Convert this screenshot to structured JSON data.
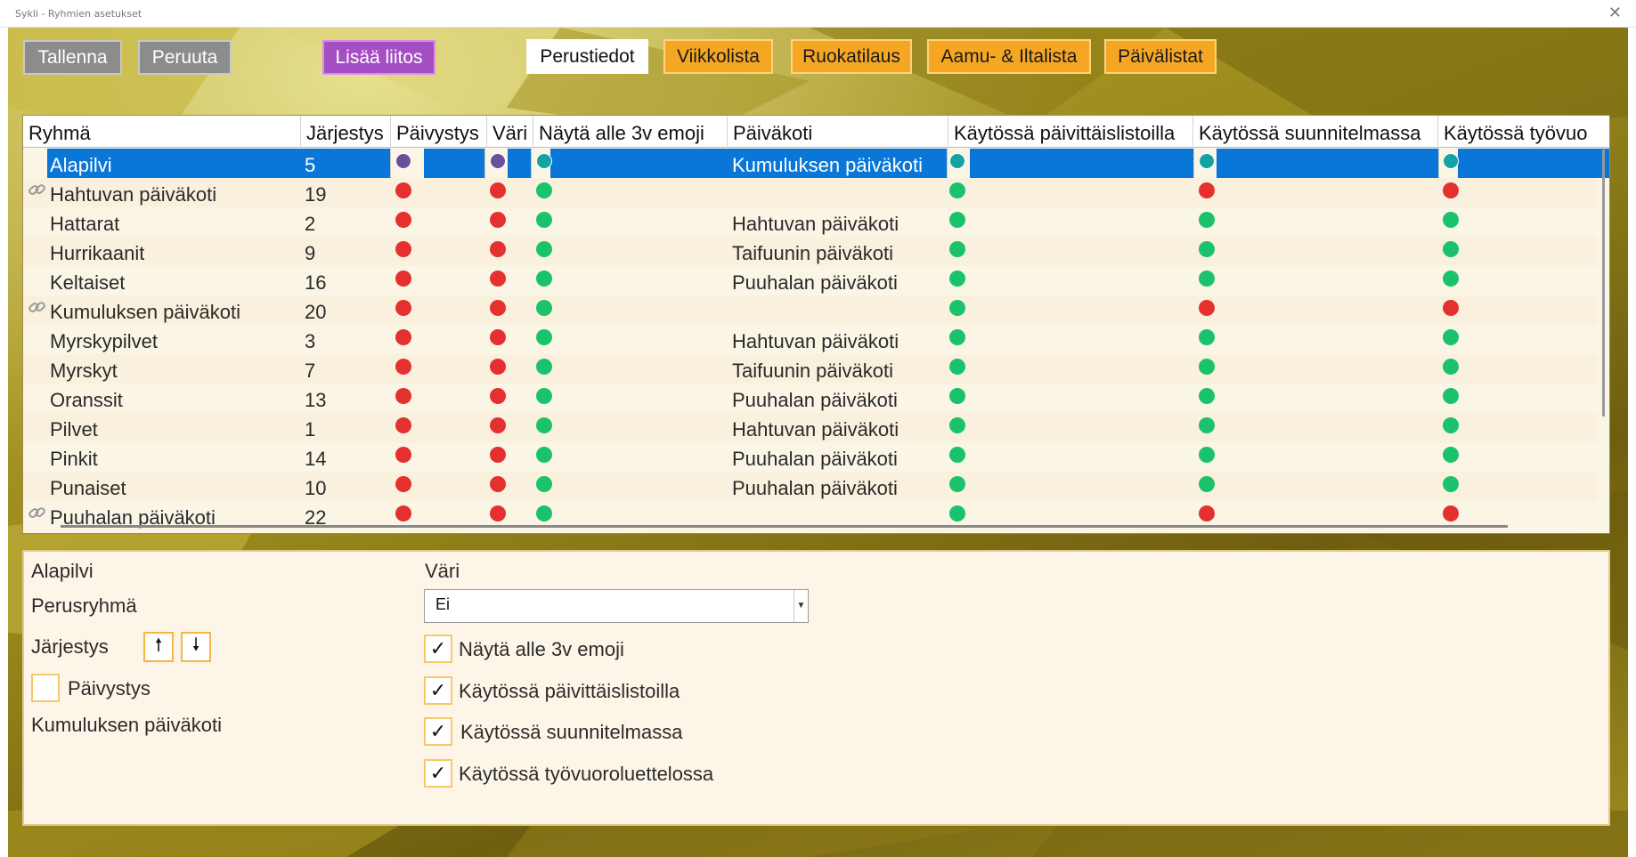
{
  "window": {
    "title": "Sykli - Ryhmien asetukset"
  },
  "toolbar": {
    "save": "Tallenna",
    "cancel": "Peruuta",
    "add_link": "Lisää liitos"
  },
  "tabs": [
    {
      "label": "Perustiedot",
      "active": true
    },
    {
      "label": "Viikkolista"
    },
    {
      "label": "Ruokatilaus"
    },
    {
      "label": "Aamu- & Iltalista"
    },
    {
      "label": "Päivälistat"
    }
  ],
  "grid": {
    "columns": [
      "Ryhmä",
      "Järjestys",
      "Päivystys",
      "Väri",
      "Näytä alle 3v emoji",
      "Päiväkoti",
      "Käytössä päivittäislistoilla",
      "Käytössä suunnitelmassa",
      "Käytössä työvuo"
    ],
    "rows": [
      {
        "name": "Alapilvi",
        "order": "5",
        "daycare": "Kumuluksen päiväkoti",
        "link": false,
        "duty": "purple",
        "color": "purple",
        "emoji": "teal",
        "daily": "teal",
        "plan": "teal",
        "shift": "teal",
        "selected": true
      },
      {
        "name": "Hahtuvan päiväkoti",
        "order": "19",
        "daycare": "",
        "link": true,
        "duty": "red",
        "color": "red",
        "emoji": "green",
        "daily": "green",
        "plan": "red",
        "shift": "red"
      },
      {
        "name": "Hattarat",
        "order": "2",
        "daycare": "Hahtuvan päiväkoti",
        "link": false,
        "duty": "red",
        "color": "red",
        "emoji": "green",
        "daily": "green",
        "plan": "green",
        "shift": "green"
      },
      {
        "name": "Hurrikaanit",
        "order": "9",
        "daycare": "Taifuunin päiväkoti",
        "link": false,
        "duty": "red",
        "color": "red",
        "emoji": "green",
        "daily": "green",
        "plan": "green",
        "shift": "green"
      },
      {
        "name": "Keltaiset",
        "order": "16",
        "daycare": "Puuhalan päiväkoti",
        "link": false,
        "duty": "red",
        "color": "red",
        "emoji": "green",
        "daily": "green",
        "plan": "green",
        "shift": "green"
      },
      {
        "name": "Kumuluksen päiväkoti",
        "order": "20",
        "daycare": "",
        "link": true,
        "duty": "red",
        "color": "red",
        "emoji": "green",
        "daily": "green",
        "plan": "red",
        "shift": "red"
      },
      {
        "name": "Myrskypilvet",
        "order": "3",
        "daycare": "Hahtuvan päiväkoti",
        "link": false,
        "duty": "red",
        "color": "red",
        "emoji": "green",
        "daily": "green",
        "plan": "green",
        "shift": "green"
      },
      {
        "name": "Myrskyt",
        "order": "7",
        "daycare": "Taifuunin päiväkoti",
        "link": false,
        "duty": "red",
        "color": "red",
        "emoji": "green",
        "daily": "green",
        "plan": "green",
        "shift": "green"
      },
      {
        "name": "Oranssit",
        "order": "13",
        "daycare": "Puuhalan päiväkoti",
        "link": false,
        "duty": "red",
        "color": "red",
        "emoji": "green",
        "daily": "green",
        "plan": "green",
        "shift": "green"
      },
      {
        "name": "Pilvet",
        "order": "1",
        "daycare": "Hahtuvan päiväkoti",
        "link": false,
        "duty": "red",
        "color": "red",
        "emoji": "green",
        "daily": "green",
        "plan": "green",
        "shift": "green"
      },
      {
        "name": "Pinkit",
        "order": "14",
        "daycare": "Puuhalan päiväkoti",
        "link": false,
        "duty": "red",
        "color": "red",
        "emoji": "green",
        "daily": "green",
        "plan": "green",
        "shift": "green"
      },
      {
        "name": "Punaiset",
        "order": "10",
        "daycare": "Puuhalan päiväkoti",
        "link": false,
        "duty": "red",
        "color": "red",
        "emoji": "green",
        "daily": "green",
        "plan": "green",
        "shift": "green"
      },
      {
        "name": "Puuhalan päiväkoti",
        "order": "22",
        "daycare": "",
        "link": true,
        "duty": "red",
        "color": "red",
        "emoji": "green",
        "daily": "green",
        "plan": "red",
        "shift": "red"
      }
    ]
  },
  "details": {
    "group_name": "Alapilvi",
    "base_group": "Perusryhmä",
    "order_label": "Järjestys",
    "duty_label": "Päivystys",
    "daycare": "Kumuluksen päiväkoti",
    "color_label": "Väri",
    "color_value": "Ei",
    "options": [
      {
        "label": "Näytä alle 3v emoji",
        "checked": true
      },
      {
        "label": "Käytössä päivittäislistoilla",
        "checked": true
      },
      {
        "label": "Käytössä suunnitelmassa",
        "checked": true
      },
      {
        "label": "Käytössä työvuoroluettelossa",
        "checked": true
      }
    ]
  },
  "icons": {
    "close": "close-icon",
    "link": "link-icon",
    "arrow_up": "arrow-up-icon",
    "arrow_down": "arrow-down-icon",
    "check": "check-icon"
  },
  "colors": {
    "selection": "#0a77d8",
    "status_red": "#e53030",
    "status_green": "#1ac36b",
    "accent_orange": "#f5a623",
    "accent_purple": "#a54fc4"
  }
}
